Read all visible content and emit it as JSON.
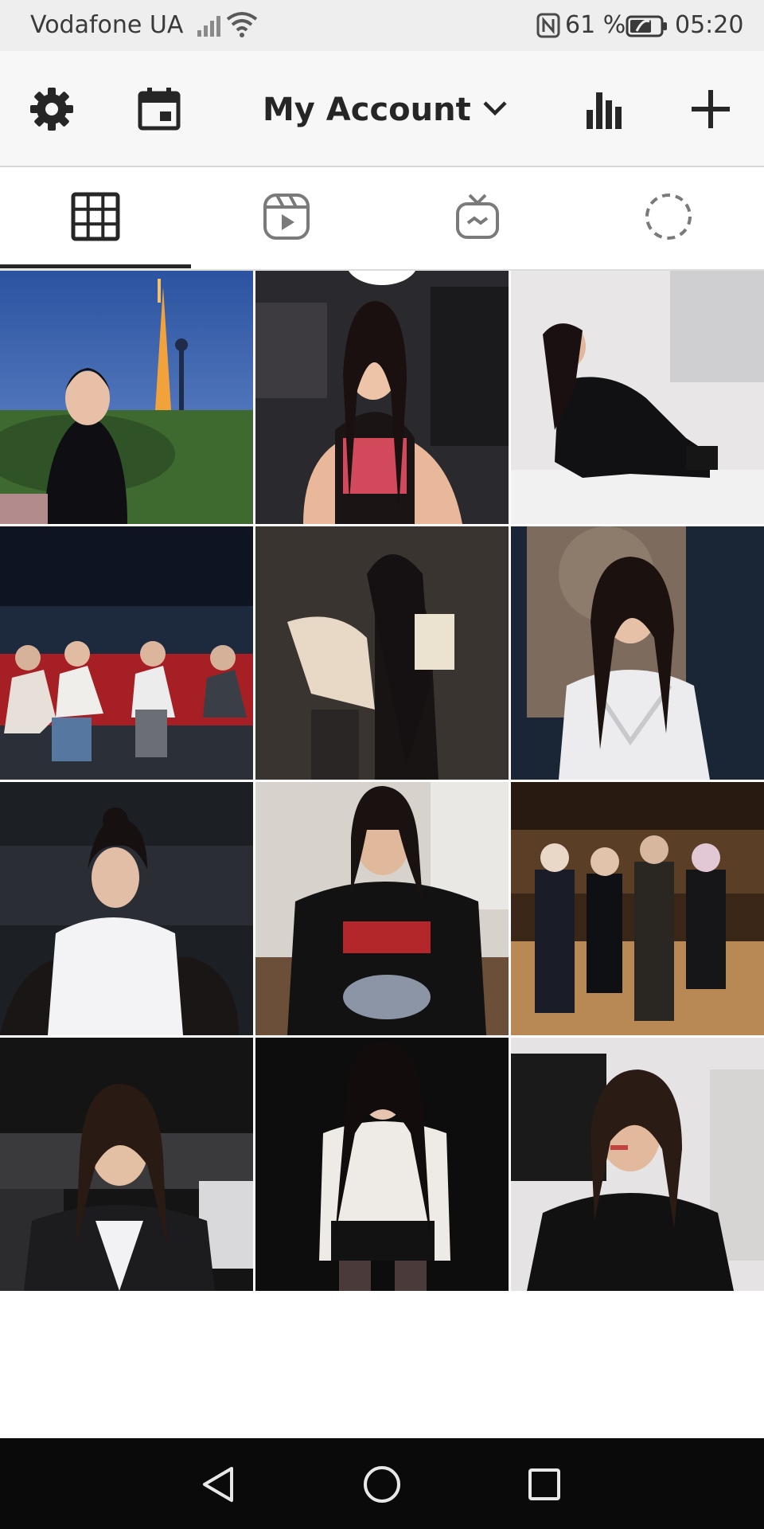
{
  "status_bar": {
    "carrier": "Vodafone UA",
    "battery_percent": "61 %",
    "time": "05:20",
    "icons": [
      "signal-icon",
      "wifi-icon",
      "nfc-icon",
      "battery-saver-icon"
    ]
  },
  "header": {
    "title": "My Account",
    "icons": [
      "gear-icon",
      "calendar-icon",
      "chevron-down-icon",
      "bar-chart-icon",
      "plus-icon"
    ]
  },
  "tabs": [
    {
      "icon": "grid-icon",
      "selected": true
    },
    {
      "icon": "reels-icon",
      "selected": false
    },
    {
      "icon": "igtv-icon",
      "selected": false
    },
    {
      "icon": "story-icon",
      "selected": false
    }
  ],
  "photos": {
    "count": 12,
    "columns": 3
  },
  "nav_bar": {
    "icons": [
      "back-triangle-icon",
      "home-circle-icon",
      "recents-square-icon"
    ]
  },
  "colors": {
    "status_bg": "#eeeeef",
    "header_bg": "#f7f7f8",
    "text": "#262626",
    "nav_bg": "#0a0a0a"
  }
}
